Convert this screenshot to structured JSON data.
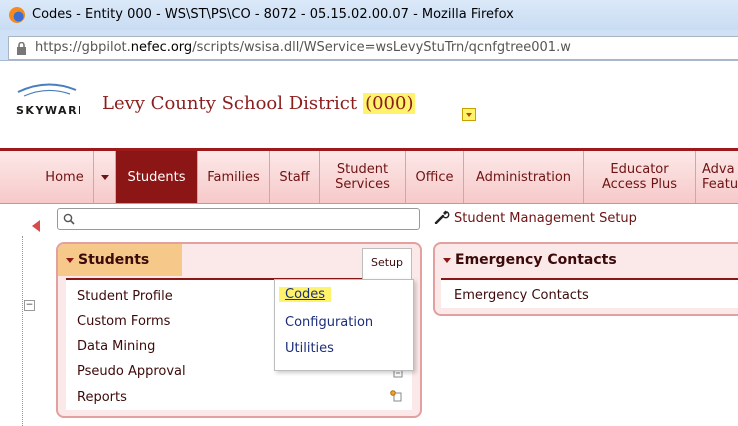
{
  "browser": {
    "window_title": "Codes - Entity 000 - WS\\ST\\PS\\CO - 8072 - 05.15.02.00.07 - Mozilla Firefox",
    "url_prefix": "https://gbpilot.",
    "url_domain": "nefec.org",
    "url_suffix": "/scripts/wsisa.dll/WService=wsLevyStuTrn/qcnfgtree001.w"
  },
  "header": {
    "logo_text": "SKYWARD",
    "district_name": "Levy County School District",
    "entity_code": "(000)"
  },
  "nav": {
    "items": [
      {
        "label": "Home"
      },
      {
        "label": "Students"
      },
      {
        "label": "Families"
      },
      {
        "label": "Staff"
      },
      {
        "label": "Student Services"
      },
      {
        "label": "Office"
      },
      {
        "label": "Administration"
      },
      {
        "label": "Educator Access Plus"
      },
      {
        "label": "Adva Featu"
      }
    ]
  },
  "search": {
    "placeholder": ""
  },
  "setup_link": {
    "label": "Student Management Setup"
  },
  "students_panel": {
    "title": "Students",
    "setup_tab": "Setup",
    "links": [
      "Student Profile",
      "Custom Forms",
      "Data Mining",
      "Pseudo Approval",
      "Reports"
    ]
  },
  "setup_menu": {
    "items": [
      "Codes",
      "Configuration",
      "Utilities"
    ]
  },
  "emergency_panel": {
    "title": "Emergency Contacts",
    "links": [
      "Emergency Contacts"
    ]
  },
  "colors": {
    "brand_maroon": "#8c1515",
    "highlight_yellow": "#fff36b",
    "panel_pink": "#fbe8e8"
  }
}
